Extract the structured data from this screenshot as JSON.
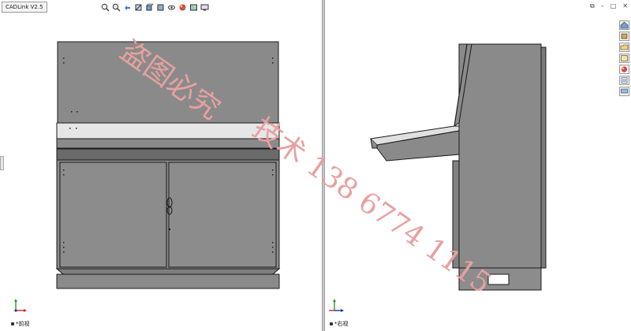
{
  "document_tab": "CADLink V2.5",
  "views": {
    "left": {
      "label": "*前视"
    },
    "right": {
      "label": "*右视"
    }
  },
  "window_controls": [
    "restore-icon",
    "minimize-icon",
    "maximize-icon",
    "close-icon"
  ],
  "heads_up_toolbar": [
    "zoom-to-fit-icon",
    "zoom-area-icon",
    "previous-view-icon",
    "section-view-icon",
    "view-orientation-icon",
    "display-style-icon",
    "hide-show-items-icon",
    "edit-appearance-icon",
    "apply-scene-icon",
    "view-settings-icon"
  ],
  "task_pane": [
    "home-icon",
    "design-library-icon",
    "file-explorer-icon",
    "view-palette-icon",
    "appearances-icon",
    "custom-properties-icon",
    "forum-icon"
  ],
  "watermark": {
    "line1": "盗图必究",
    "line2": "技术 138 6774 1115"
  },
  "colors": {
    "panel": "#8a8a8a",
    "panel_dark": "#6c6c6c",
    "strip_light": "#e6e6e6",
    "outline": "#1a1a1a",
    "watermark": "#e8a0a0"
  }
}
